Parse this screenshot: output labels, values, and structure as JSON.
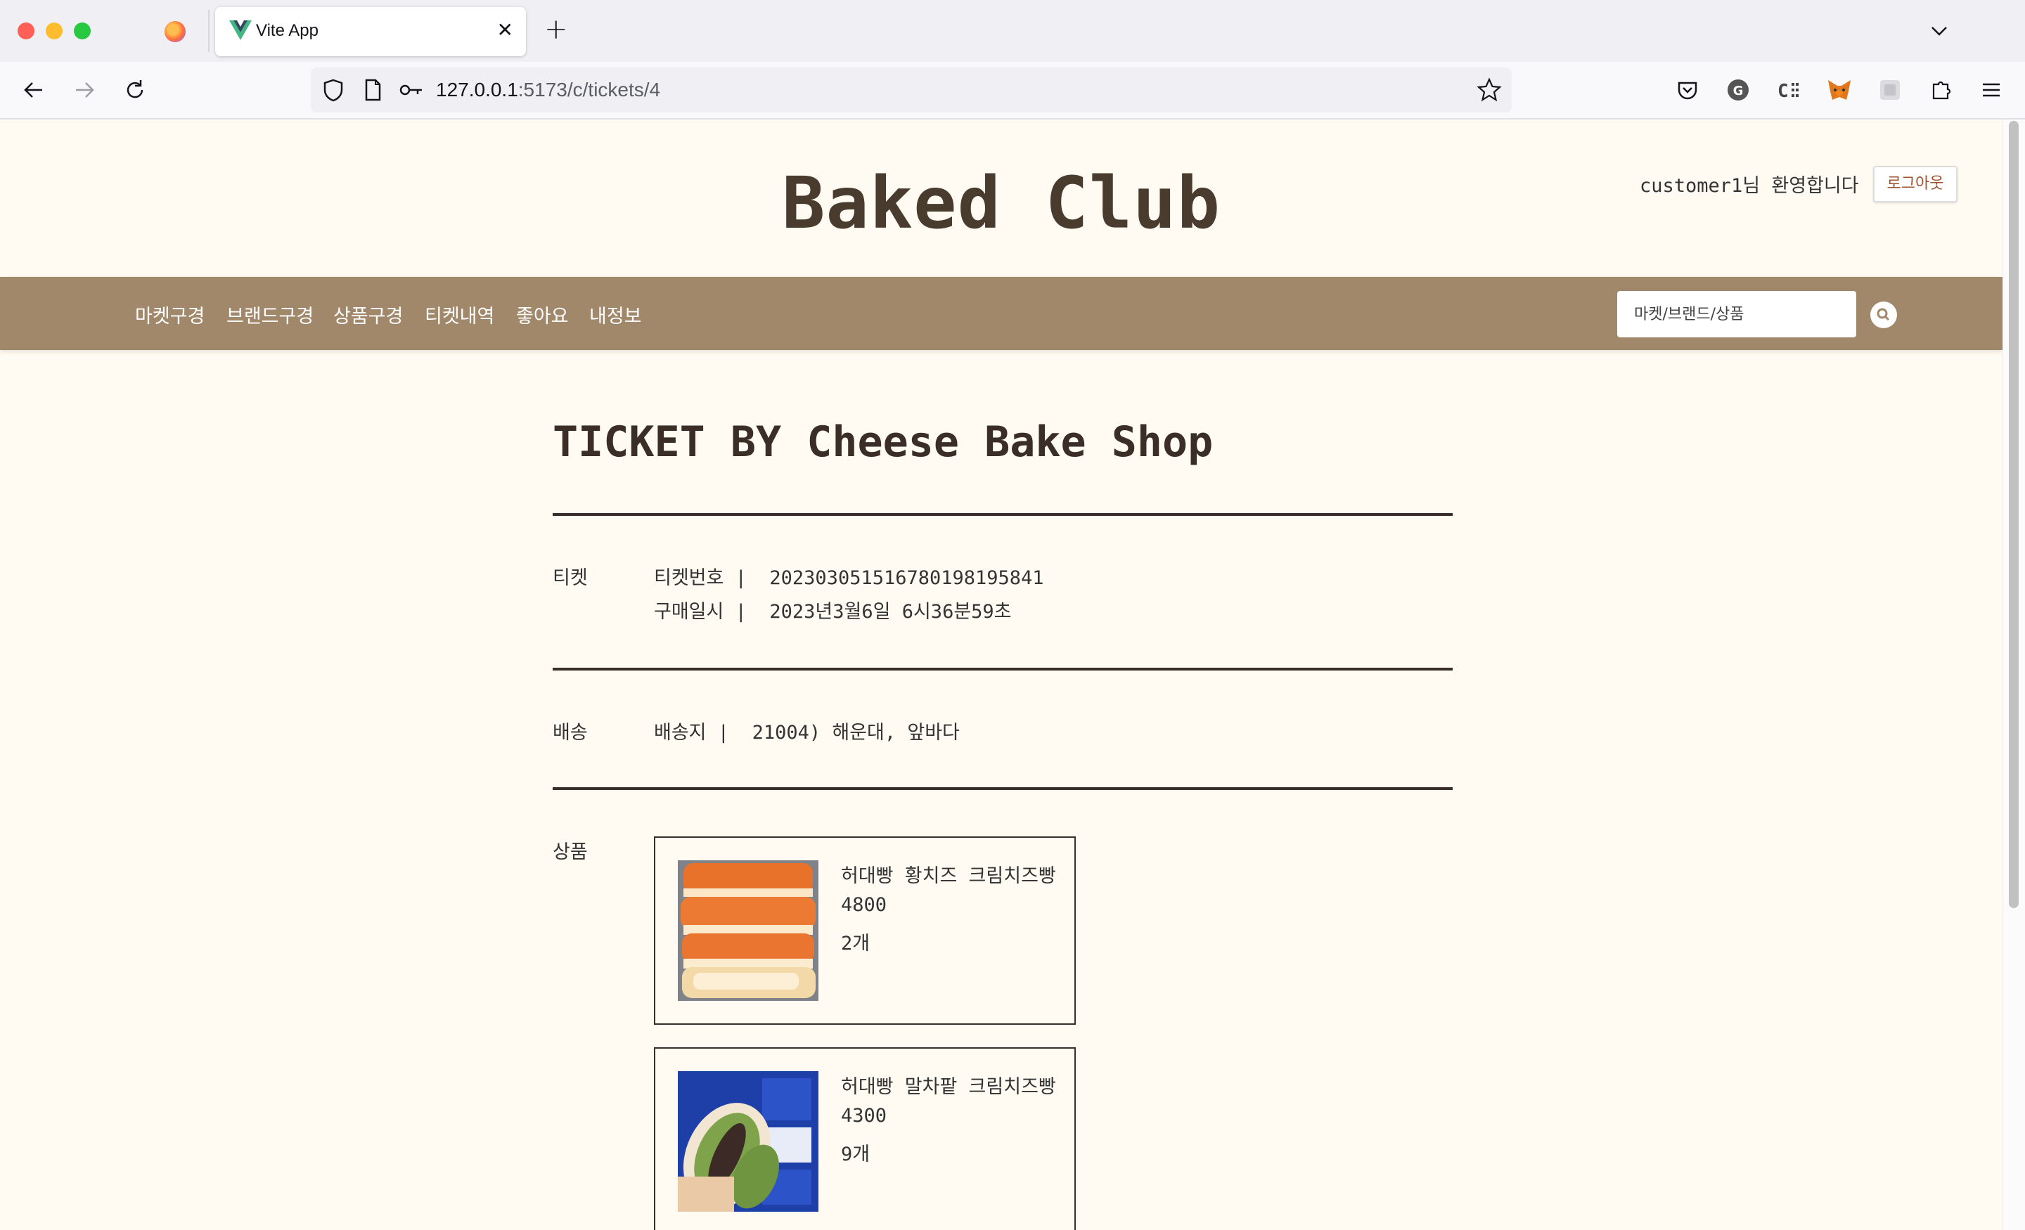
{
  "browser": {
    "tab_title": "Vite App",
    "url_host": "127.0.0.1",
    "url_rest": ":5173/c/tickets/4"
  },
  "header": {
    "brand": "Baked Club",
    "welcome": "customer1님 환영합니다",
    "logout_label": "로그아웃"
  },
  "menu": {
    "items": [
      "마켓구경",
      "브랜드구경",
      "상품구경",
      "티켓내역",
      "좋아요",
      "내정보"
    ],
    "search_placeholder": "마켓/브랜드/상품"
  },
  "ticket": {
    "heading": "TICKET BY Cheese Bake Shop",
    "ticket_section_label": "티켓",
    "number_line": "티켓번호 |  20230305151678019819584 1",
    "number_label": "티켓번호",
    "number_value": "2023030515167801981958​41",
    "date_label": "구매일시",
    "date_value": "2023년3월6일 6시36분59초",
    "delivery_section_label": "배송",
    "address_label": "배송지",
    "address_value": "21004) 해운대, 앞바다",
    "products_section_label": "상품",
    "products": [
      {
        "name": "허대빵 황치즈 크림치즈빵",
        "price": "4800",
        "qty": "2개",
        "thumb_icon": "cheese-bread-photo"
      },
      {
        "name": "허대빵 말차팥 크림치즈빵",
        "price": "4300",
        "qty": "9개",
        "thumb_icon": "matcha-bread-photo"
      }
    ]
  },
  "colors": {
    "page_bg": "#fffbf2",
    "menubar_bg": "#a1886b",
    "heading_text": "#3a2e26"
  }
}
